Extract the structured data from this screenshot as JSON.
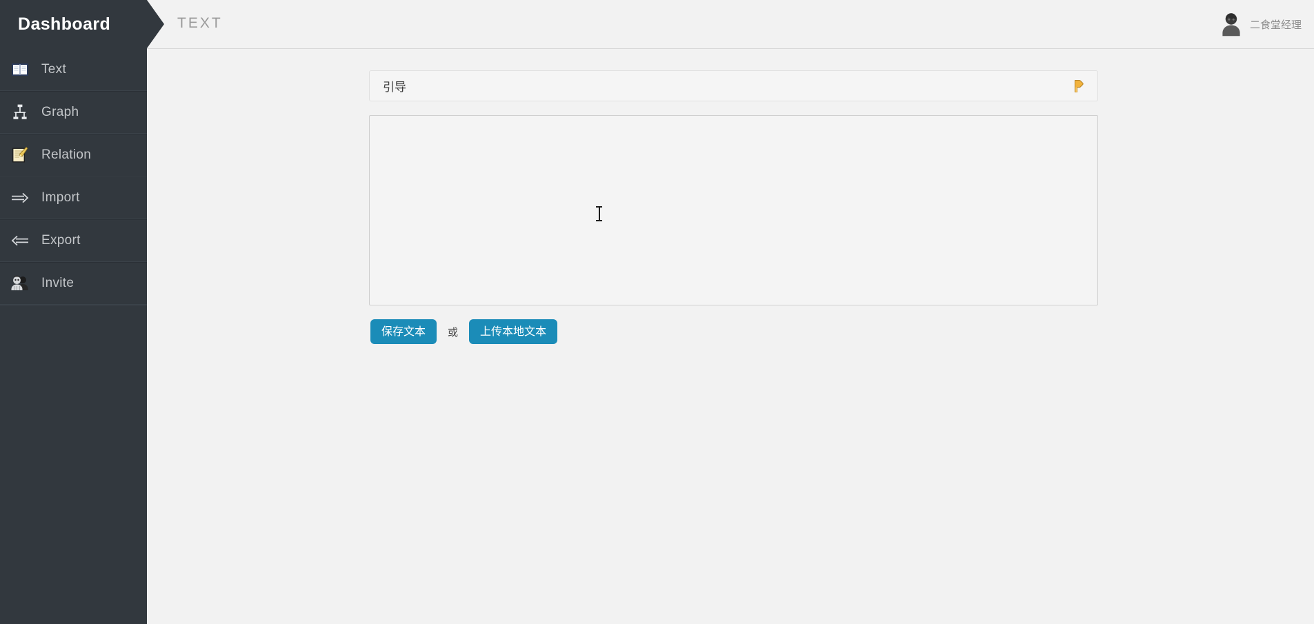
{
  "header": {
    "brand_title": "Dashboard",
    "page_title": "TEXT",
    "user_name": "二食堂经理",
    "avatar_icon": "user-avatar-icon"
  },
  "sidebar": {
    "items": [
      {
        "label": "Text",
        "icon": "book-icon"
      },
      {
        "label": "Graph",
        "icon": "graph-icon"
      },
      {
        "label": "Relation",
        "icon": "note-pencil-icon"
      },
      {
        "label": "Import",
        "icon": "arrow-right-icon"
      },
      {
        "label": "Export",
        "icon": "arrow-left-icon"
      },
      {
        "label": "Invite",
        "icon": "users-icon"
      }
    ]
  },
  "main": {
    "panel": {
      "header_title": "引导",
      "header_icon": "pointing-hand-icon",
      "textarea_value": "",
      "textarea_placeholder": ""
    },
    "actions": {
      "save_label": "保存文本",
      "or_label": "或",
      "upload_label": "上传本地文本"
    }
  },
  "colors": {
    "sidebar_bg": "#32383e",
    "button_primary": "#1b8cb8",
    "page_bg": "#f2f2f2",
    "accent_icon": "#f2b33d"
  }
}
